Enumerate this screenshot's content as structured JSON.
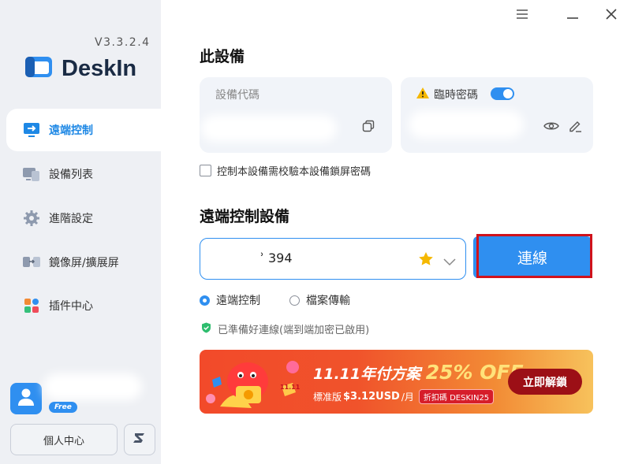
{
  "app": {
    "name": "DeskIn",
    "version": "V3.3.2.4"
  },
  "sidebar": {
    "items": [
      {
        "label": "遠端控制",
        "icon": "monitor-arrow-icon",
        "active": true
      },
      {
        "label": "設備列表",
        "icon": "devices-icon",
        "active": false
      },
      {
        "label": "進階設定",
        "icon": "gear-icon",
        "active": false
      },
      {
        "label": "鏡像屏/擴展屏",
        "icon": "mirror-screen-icon",
        "active": false
      },
      {
        "label": "插件中心",
        "icon": "plugin-grid-icon",
        "active": false
      }
    ],
    "user": {
      "plan_badge": "Free",
      "user_center_label": "個人中心"
    }
  },
  "this_device": {
    "title": "此設備",
    "device_code_label": "設備代碼",
    "temp_password_label": "臨時密碼",
    "temp_password_enabled": true,
    "lock_screen_checkbox_label": "控制本設備需校驗本設備鎖屏密碼",
    "lock_screen_checked": false
  },
  "remote": {
    "title": "遠端控制設備",
    "device_input_value": "ʾ 394",
    "connect_label": "連線",
    "modes": [
      {
        "label": "遠端控制",
        "selected": true
      },
      {
        "label": "檔案傳輸",
        "selected": false
      }
    ],
    "status_note": "已準備好連線(端到端加密已啟用)"
  },
  "promo": {
    "headline": "11.11年付方案",
    "discount": "25% OFF",
    "sub_text_prefix": "標准版",
    "price": "$3.12USD",
    "per": "/月",
    "code_label": "折扣碼 DESKIN25",
    "cta": "立即解鎖",
    "mascot_tag": "11.11"
  },
  "colors": {
    "accent": "#2f8ff0",
    "sidebar_bg": "#eef0f4",
    "highlight_outline": "#d0121b"
  }
}
